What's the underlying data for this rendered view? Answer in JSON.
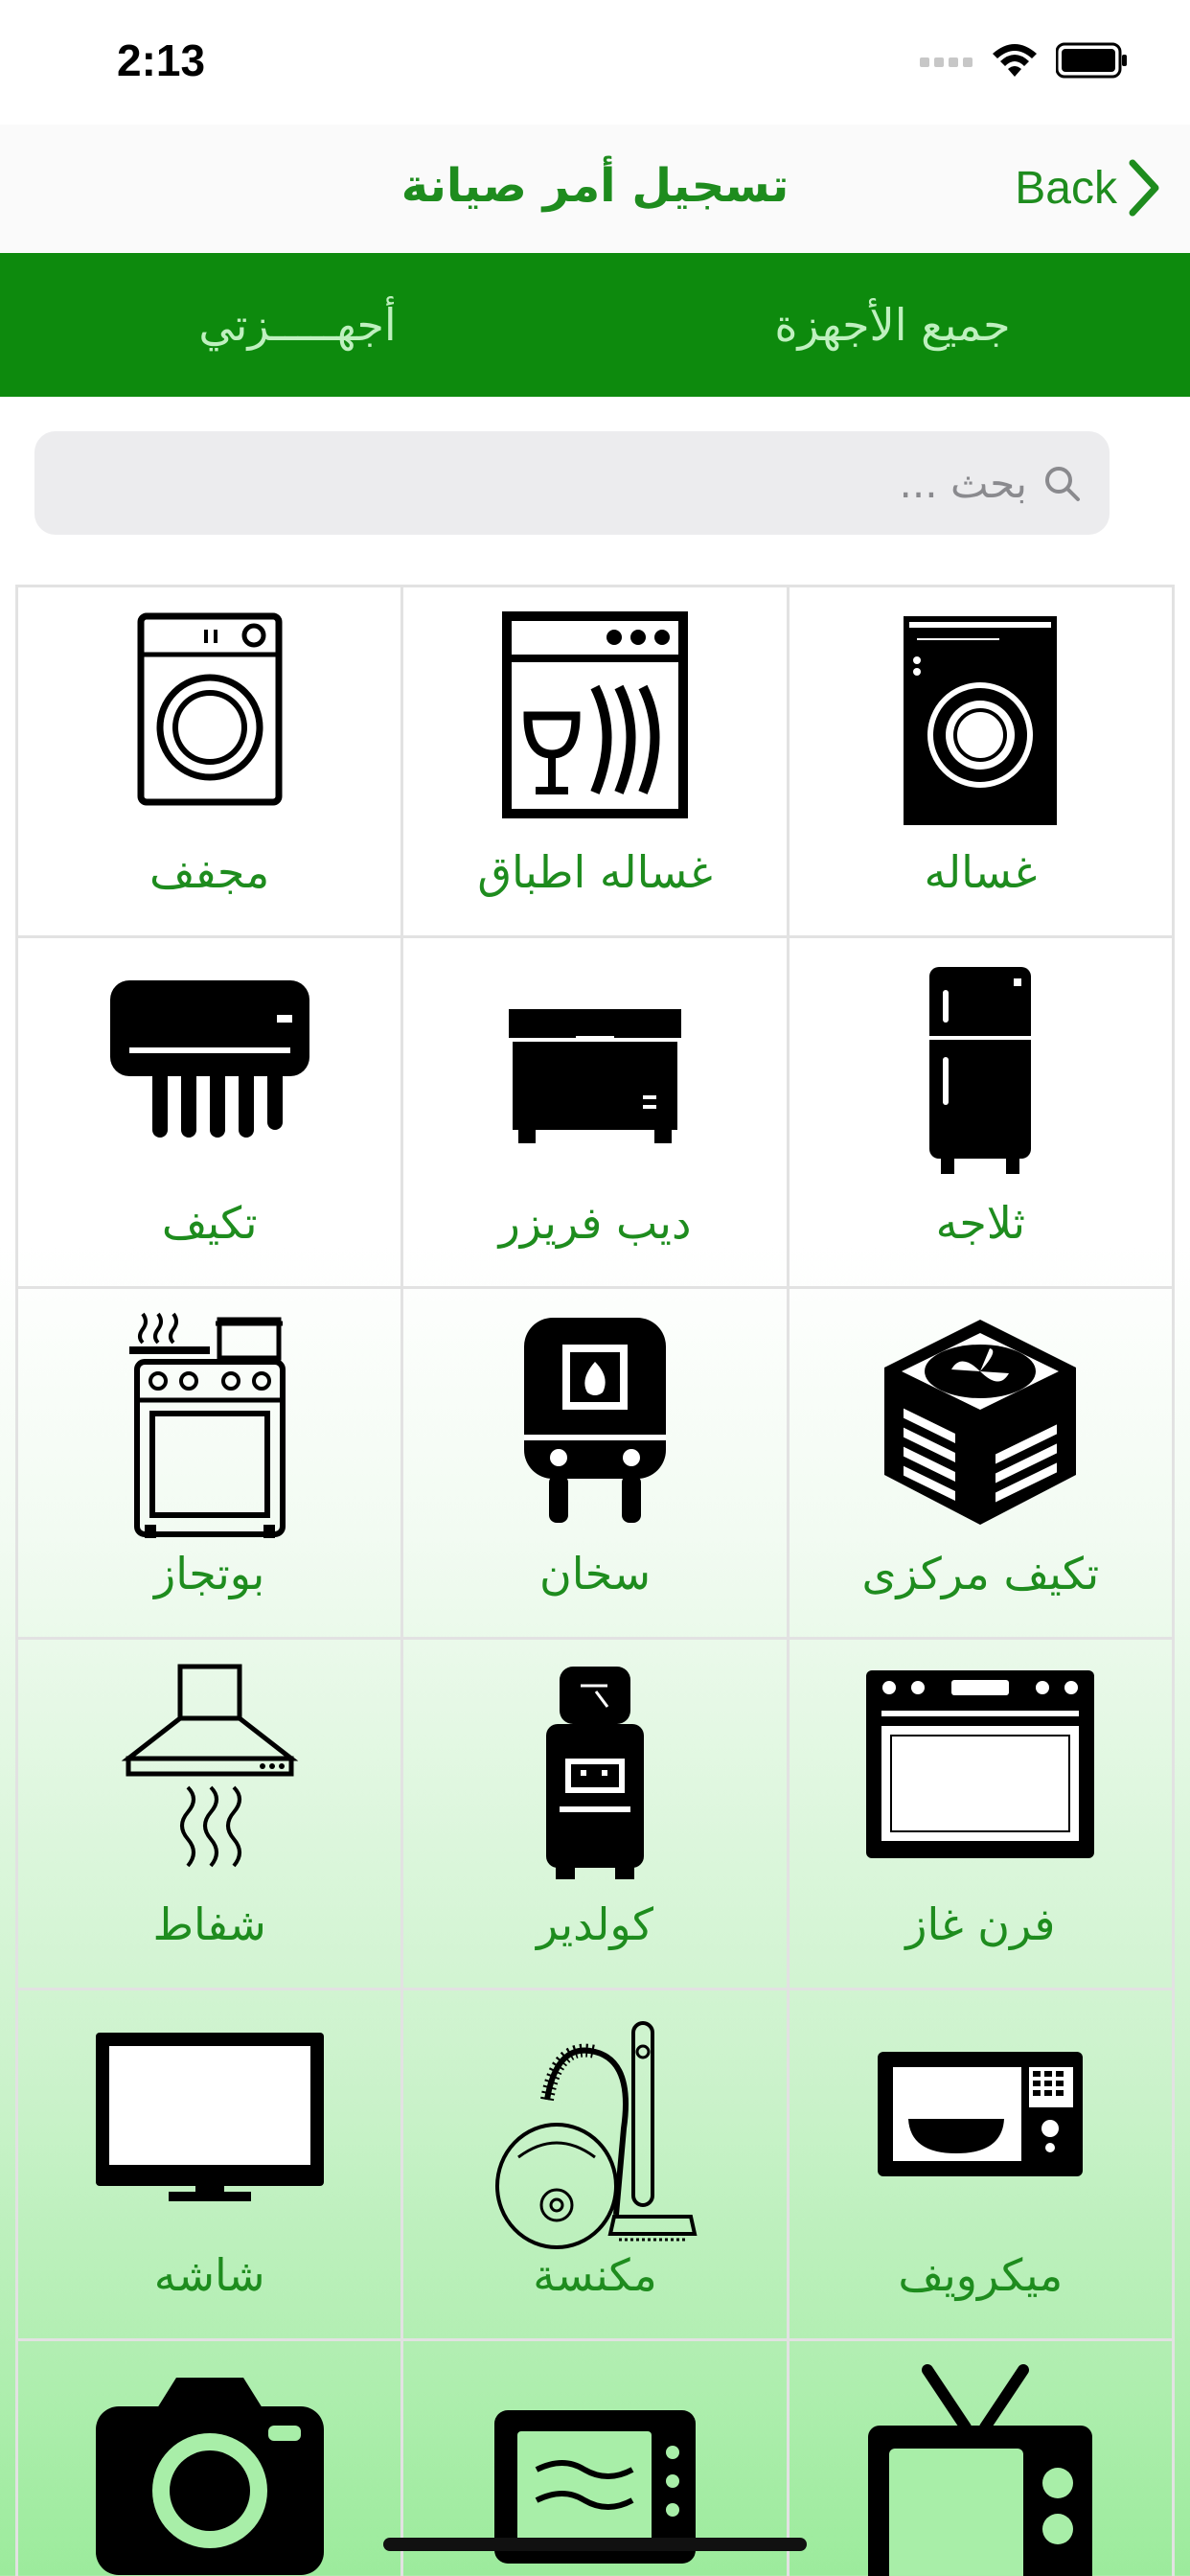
{
  "status_bar": {
    "time": "2:13"
  },
  "nav": {
    "title": "تسجيل أمر صيانة",
    "back_label": "Back"
  },
  "tabs": [
    {
      "label": "جميع الأجهزة"
    },
    {
      "label": "أجهـــــزتي"
    }
  ],
  "search": {
    "placeholder": "بحث ..."
  },
  "devices": [
    {
      "label": "غساله",
      "icon": "washing-machine-icon"
    },
    {
      "label": "غساله اطباق",
      "icon": "dishwasher-icon"
    },
    {
      "label": "مجفف",
      "icon": "dryer-icon"
    },
    {
      "label": "ثلاجه",
      "icon": "refrigerator-icon"
    },
    {
      "label": "ديب فريزر",
      "icon": "deep-freezer-icon"
    },
    {
      "label": "تكيف",
      "icon": "air-conditioner-icon"
    },
    {
      "label": "تكيف مركزى",
      "icon": "central-ac-icon"
    },
    {
      "label": "سخان",
      "icon": "water-heater-icon"
    },
    {
      "label": "بوتجاز",
      "icon": "gas-stove-icon"
    },
    {
      "label": "فرن غاز",
      "icon": "gas-oven-icon"
    },
    {
      "label": "كولدير",
      "icon": "water-cooler-icon"
    },
    {
      "label": "شفاط",
      "icon": "range-hood-icon"
    },
    {
      "label": "ميكرويف",
      "icon": "microwave-icon"
    },
    {
      "label": "مكنسة",
      "icon": "vacuum-cleaner-icon"
    },
    {
      "label": "شاشه",
      "icon": "monitor-screen-icon"
    },
    {
      "label": "",
      "icon": "tv-icon"
    },
    {
      "label": "",
      "icon": "toaster-oven-icon"
    },
    {
      "label": "",
      "icon": "camera-icon"
    }
  ],
  "colors": {
    "accent": "#0d8a0d",
    "label": "#1e8c1e",
    "tab_text": "#bff0bf"
  }
}
